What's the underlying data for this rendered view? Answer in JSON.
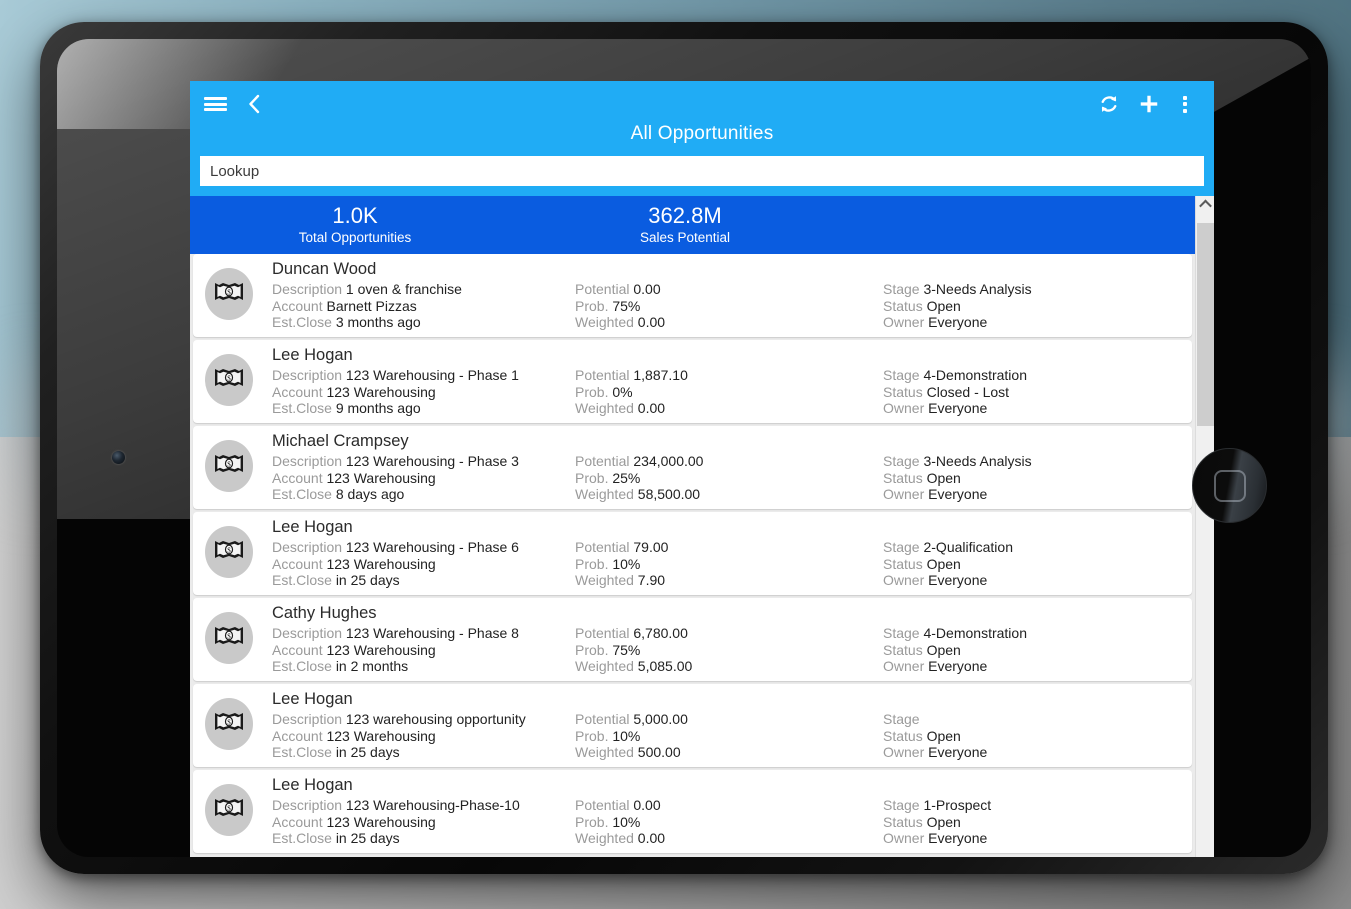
{
  "appbar": {
    "title": "All Opportunities",
    "menu_icon": "hamburger-icon",
    "back_icon": "chevron-left-icon",
    "refresh_icon": "refresh-icon",
    "add_icon": "plus-icon",
    "more_icon": "overflow-menu-icon",
    "accent_color": "#20acf5"
  },
  "search": {
    "value": "Lookup",
    "placeholder": "Lookup"
  },
  "stats": {
    "background_color": "#0a5ce0",
    "items": [
      {
        "value": "1.0K",
        "label": "Total Opportunities"
      },
      {
        "value": "362.8M",
        "label": "Sales Potential"
      }
    ]
  },
  "labels": {
    "description": "Description",
    "account": "Account",
    "est_close": "Est.Close",
    "potential": "Potential",
    "prob": "Prob.",
    "weighted": "Weighted",
    "stage": "Stage",
    "status": "Status",
    "owner": "Owner"
  },
  "rows": [
    {
      "name": "Duncan Wood",
      "avatar_icon": "banknote-icon",
      "description": "1 oven & franchise",
      "account": "Barnett Pizzas",
      "est_close": "3 months ago",
      "potential": "0.00",
      "prob": "75%",
      "weighted": "0.00",
      "stage": "3-Needs Analysis",
      "status": "Open",
      "owner": "Everyone"
    },
    {
      "name": "Lee Hogan",
      "avatar_icon": "banknote-icon",
      "description": "123 Warehousing - Phase 1",
      "account": "123 Warehousing",
      "est_close": "9 months ago",
      "potential": "1,887.10",
      "prob": "0%",
      "weighted": "0.00",
      "stage": "4-Demonstration",
      "status": "Closed - Lost",
      "owner": "Everyone"
    },
    {
      "name": "Michael Crampsey",
      "avatar_icon": "banknote-icon",
      "description": "123 Warehousing - Phase 3",
      "account": "123 Warehousing",
      "est_close": "8 days ago",
      "potential": "234,000.00",
      "prob": "25%",
      "weighted": "58,500.00",
      "stage": "3-Needs Analysis",
      "status": "Open",
      "owner": "Everyone"
    },
    {
      "name": "Lee Hogan",
      "avatar_icon": "banknote-icon",
      "description": "123 Warehousing - Phase 6",
      "account": "123 Warehousing",
      "est_close": "in 25 days",
      "potential": "79.00",
      "prob": "10%",
      "weighted": "7.90",
      "stage": "2-Qualification",
      "status": "Open",
      "owner": "Everyone"
    },
    {
      "name": "Cathy Hughes",
      "avatar_icon": "banknote-icon",
      "description": "123 Warehousing - Phase 8",
      "account": "123 Warehousing",
      "est_close": "in 2 months",
      "potential": "6,780.00",
      "prob": "75%",
      "weighted": "5,085.00",
      "stage": "4-Demonstration",
      "status": "Open",
      "owner": "Everyone"
    },
    {
      "name": "Lee Hogan",
      "avatar_icon": "banknote-icon",
      "description": "123 warehousing opportunity",
      "account": "123 Warehousing",
      "est_close": "in 25 days",
      "potential": "5,000.00",
      "prob": "10%",
      "weighted": "500.00",
      "stage": "",
      "status": "Open",
      "owner": "Everyone"
    },
    {
      "name": "Lee Hogan",
      "avatar_icon": "banknote-icon",
      "description": "123 Warehousing-Phase-10",
      "account": "123 Warehousing",
      "est_close": "in 25 days",
      "potential": "0.00",
      "prob": "10%",
      "weighted": "0.00",
      "stage": "1-Prospect",
      "status": "Open",
      "owner": "Everyone"
    }
  ],
  "scrollbar": {
    "up_icon": "chevron-up-icon",
    "down_icon": "chevron-down-icon"
  },
  "device": {
    "home_icon": "home-button-icon",
    "camera_icon": "front-camera-icon"
  }
}
